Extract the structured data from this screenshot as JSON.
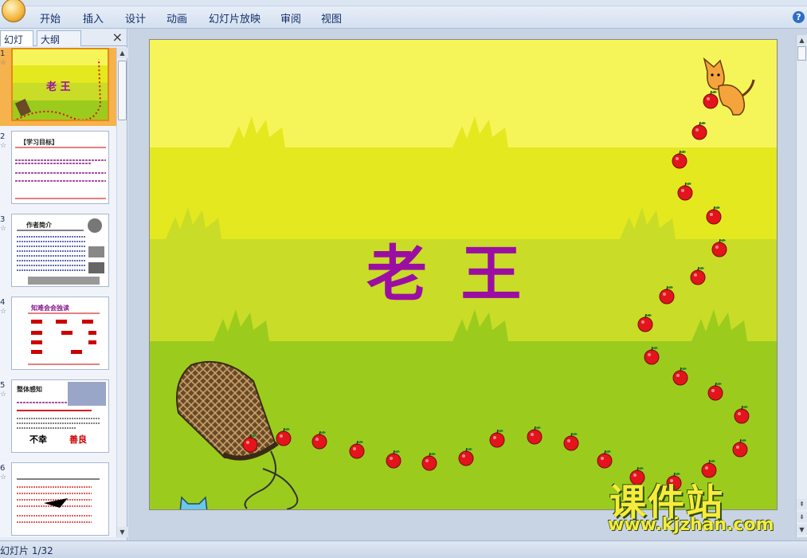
{
  "menu": {
    "items": [
      "开始",
      "插入",
      "设计",
      "动画",
      "幻灯片放映",
      "审阅",
      "视图"
    ]
  },
  "panel": {
    "tab_slides": "幻灯片",
    "tab_outline": "大纲",
    "close": "×"
  },
  "thumbnails": [
    {
      "num": "1",
      "title": "老 王"
    },
    {
      "num": "2",
      "title": "【学习目标】"
    },
    {
      "num": "3",
      "title": "作者简介"
    },
    {
      "num": "4",
      "title": "知难会会独读"
    },
    {
      "num": "5",
      "title": "整体感知",
      "label_a": "不幸",
      "label_b": "善良"
    },
    {
      "num": "6",
      "title": ""
    }
  ],
  "slide": {
    "title": "老 王",
    "colors": {
      "band1": "#f5f55a",
      "band2": "#e4e81e",
      "band3": "#c9dc27",
      "band4": "#9bcc1d",
      "title": "#9b0ea3"
    }
  },
  "status": {
    "text": "幻灯片 1/32"
  },
  "watermark": {
    "title": "课件站",
    "url": "www.kjzhan.com"
  },
  "icons": [
    "office-button-icon",
    "help-icon",
    "close-icon",
    "scroll-up-icon",
    "scroll-down-icon",
    "cat-icon",
    "basket-icon",
    "apple-icon"
  ]
}
